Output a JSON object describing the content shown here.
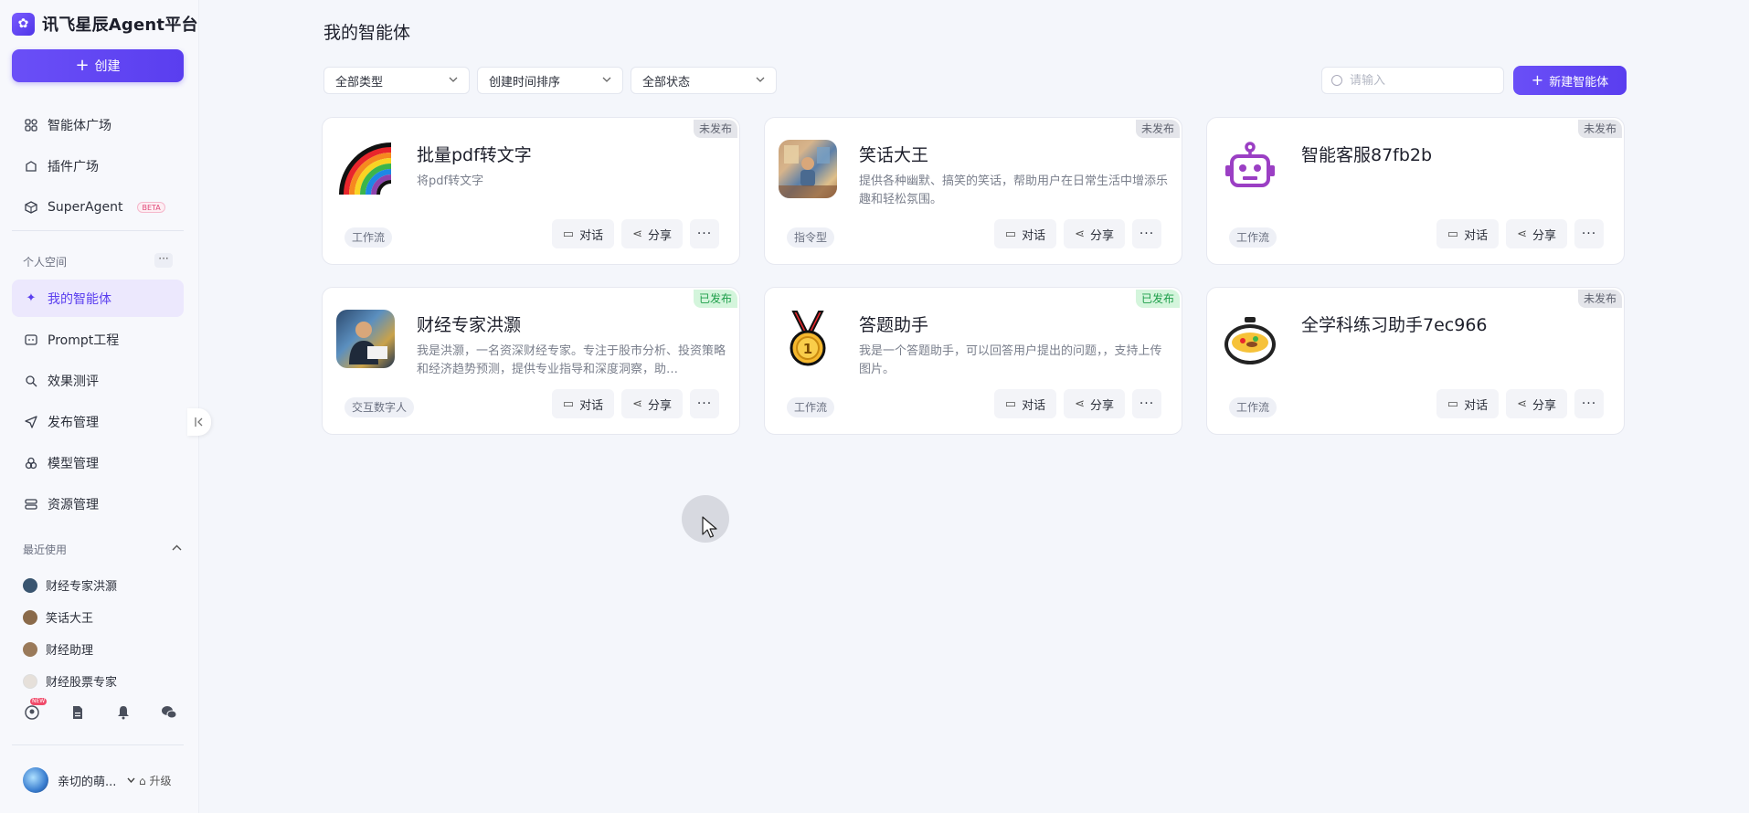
{
  "app": {
    "title": "讯飞星辰Agent平台",
    "logo_glyph": "✿"
  },
  "sidebar": {
    "create_label": "创建",
    "top_items": [
      {
        "label": "智能体广场",
        "icon": "grid-icon"
      },
      {
        "label": "插件广场",
        "icon": "plugin-icon"
      },
      {
        "label": "SuperAgent",
        "icon": "cube-icon",
        "badge": "BETA"
      }
    ],
    "personal_space_title": "个人空间",
    "personal_space_more": "···",
    "items": [
      {
        "label": "我的智能体",
        "icon": "sparkle-icon",
        "active": true
      },
      {
        "label": "Prompt工程",
        "icon": "prompt-icon"
      },
      {
        "label": "效果测评",
        "icon": "eval-icon"
      },
      {
        "label": "发布管理",
        "icon": "send-icon"
      },
      {
        "label": "模型管理",
        "icon": "model-icon"
      },
      {
        "label": "资源管理",
        "icon": "resource-icon"
      }
    ],
    "recent_title": "最近使用",
    "recent": [
      {
        "label": "财经专家洪灏",
        "color": "#3a5570"
      },
      {
        "label": "笑话大王",
        "color": "#8a6a4a"
      },
      {
        "label": "财经助理",
        "color": "#9a7a5a"
      },
      {
        "label": "财经股票专家",
        "color": "#e6e0da"
      }
    ],
    "tools": {
      "new_badge": "NEW"
    },
    "user": {
      "name": "亲切的萌...",
      "upgrade_label": "升级"
    }
  },
  "main": {
    "page_title": "我的智能体",
    "filters": {
      "type": "全部类型",
      "sort": "创建时间排序",
      "status": "全部状态"
    },
    "search_placeholder": "请输入",
    "new_agent_label": "新建智能体",
    "chat_label": "对话",
    "share_label": "分享",
    "more_label": "···",
    "cards": [
      {
        "title": "批量pdf转文字",
        "desc": "将pdf转文字",
        "tag": "工作流",
        "status": "未发布",
        "published": false,
        "image": "rainbow"
      },
      {
        "title": "笑话大王",
        "desc": "提供各种幽默、搞笑的笑话，帮助用户在日常生活中增添乐趣和轻松氛围。",
        "tag": "指令型",
        "status": "未发布",
        "published": false,
        "image": "photo-room"
      },
      {
        "title": "智能客服87fb2b",
        "desc": "",
        "tag": "工作流",
        "status": "未发布",
        "published": false,
        "image": "robot"
      },
      {
        "title": "财经专家洪灏",
        "desc": "我是洪灏，一名资深财经专家。专注于股市分析、投资策略和经济趋势预测，提供专业指导和深度洞察，助…",
        "tag": "交互数字人",
        "status": "已发布",
        "published": true,
        "image": "photo-man"
      },
      {
        "title": "答题助手",
        "desc": "我是一个答题助手，可以回答用户提出的问题，，支持上传图片。",
        "tag": "工作流",
        "status": "已发布",
        "published": true,
        "image": "medal"
      },
      {
        "title": "全学科练习助手7ec966",
        "desc": "",
        "tag": "工作流",
        "status": "未发布",
        "published": false,
        "image": "paella"
      }
    ]
  },
  "colors": {
    "brand": "#5a3eef",
    "published_bg": "#d4f5dc",
    "unpublished_bg": "#e4e5ea"
  }
}
